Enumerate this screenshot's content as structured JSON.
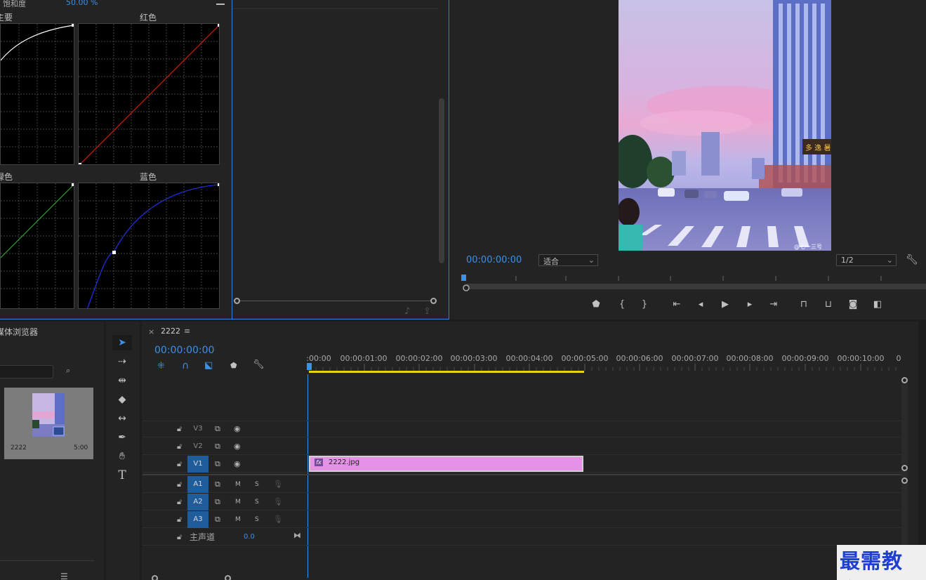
{
  "lumetri": {
    "saturation_label": "饱和度",
    "saturation_value": "50.00 %",
    "curve_master": "主要",
    "curve_red": "红色",
    "curve_green": "绿色",
    "curve_blue": "蓝色"
  },
  "program": {
    "timecode": "00:00:00:00",
    "zoom": "适合",
    "resolution": "1/2",
    "preview_watermark": "@七一三号"
  },
  "media_browser": {
    "title": "媒体浏览器",
    "item_name": "2222",
    "item_duration": "5:00"
  },
  "timeline": {
    "tab_title": "2222",
    "timecode": "00:00:00:00",
    "ruler": [
      ":00:00",
      "00:00:01:00",
      "00:00:02:00",
      "00:00:03:00",
      "00:00:04:00",
      "00:00:05:00",
      "00:00:06:00",
      "00:00:07:00",
      "00:00:08:00",
      "00:00:09:00",
      "00:00:10:00",
      "0"
    ],
    "video_tracks": [
      "V3",
      "V2",
      "V1"
    ],
    "audio_tracks": [
      "A1",
      "A2",
      "A3"
    ],
    "mute": "M",
    "solo": "S",
    "master_label": "主声道",
    "master_value": "0.0",
    "clip_name": "2222.jpg",
    "clip_fx": "fx"
  },
  "watermark": "最需教育",
  "colors": {
    "accent": "#3c90e6",
    "clip": "#e592e6",
    "track_target": "#1f5c9c",
    "work_area": "#e8d21a"
  }
}
